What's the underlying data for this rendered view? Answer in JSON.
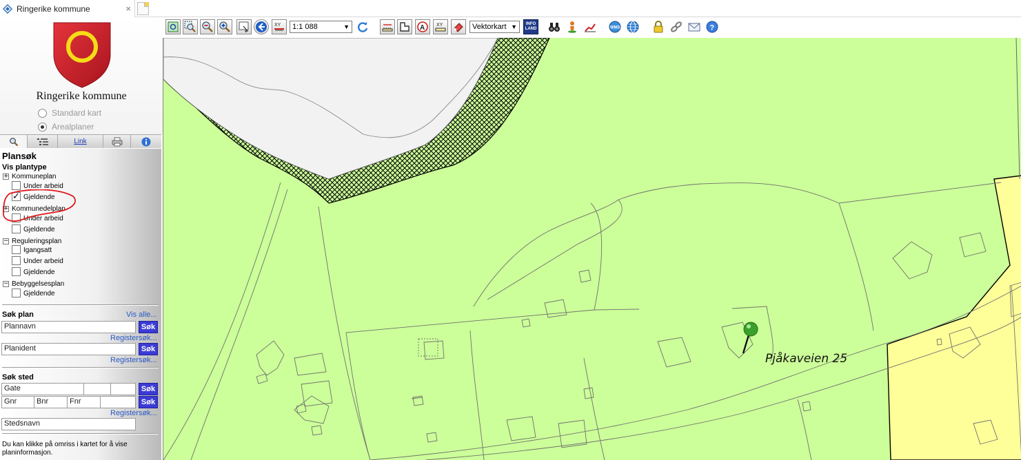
{
  "browser": {
    "tab_title": "Ringerike kommune",
    "close_glyph": "×"
  },
  "sidebar": {
    "brand": "Ringerike kommune",
    "map_modes": [
      {
        "label": "Standard kart",
        "selected": false
      },
      {
        "label": "Arealplaner",
        "selected": true
      }
    ],
    "tabs": [
      {
        "icon": "search-icon",
        "active": true
      },
      {
        "icon": "layers-icon",
        "active": false
      },
      {
        "label": "Link",
        "active": false
      },
      {
        "icon": "print-icon",
        "active": false
      },
      {
        "icon": "info-icon",
        "active": false
      }
    ]
  },
  "plansok": {
    "title": "Plansøk",
    "subtitle": "Vis plantype",
    "groups": [
      {
        "name": "Kommuneplan",
        "toggle": "+",
        "items": [
          {
            "label": "Under arbeid",
            "checked": false
          },
          {
            "label": "Gjeldende",
            "checked": true
          }
        ]
      },
      {
        "name": "Kommunedelplan",
        "toggle": "+",
        "items": [
          {
            "label": "Under arbeid",
            "checked": false
          },
          {
            "label": "Gjeldende",
            "checked": false
          }
        ]
      },
      {
        "name": "Reguleringsplan",
        "toggle": "−",
        "items": [
          {
            "label": "Igangsatt",
            "checked": false
          },
          {
            "label": "Under arbeid",
            "checked": false
          },
          {
            "label": "Gjeldende",
            "checked": false
          }
        ]
      },
      {
        "name": "Bebyggelsesplan",
        "toggle": "−",
        "items": [
          {
            "label": "Gjeldende",
            "checked": false
          }
        ]
      }
    ]
  },
  "sok_plan": {
    "title": "Søk plan",
    "vis_alle": "Vis alle...",
    "plannavn": "Plannavn",
    "planident": "Planident",
    "button": "Søk",
    "registersok": "Registersøk..."
  },
  "sok_sted": {
    "title": "Søk sted",
    "gate": "Gate",
    "gnr": "Gnr",
    "bnr": "Bnr",
    "fnr": "Fnr",
    "stedsnavn": "Stedsnavn",
    "button": "Søk",
    "registersok": "Registersøk..."
  },
  "help_text": "Du kan klikke på omriss i kartet for å vise planinformasjon.",
  "toolbar": {
    "scale": "1:1 088",
    "map_type": "Vektorkart",
    "xy_label": "XY",
    "wms_label": "WMS",
    "infoland_label": "INFO LAND"
  },
  "map": {
    "address_label": "Pjåkaveien 25",
    "colors": {
      "zone_green": "#ccff99",
      "zone_yellow": "#ffff99",
      "water": "#f2f2f2",
      "hatch": "#000000",
      "marker": "#3aa02a"
    }
  }
}
